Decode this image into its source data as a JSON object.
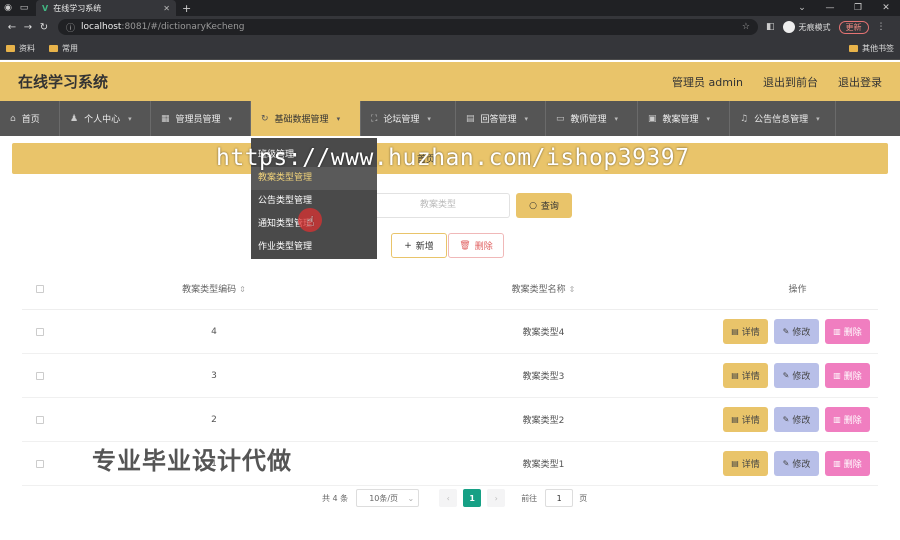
{
  "browser": {
    "tab_title": "在线学习系统",
    "url_host": "localhost",
    "url_path": ":8081/#/dictionaryKecheng",
    "profile_label": "无痕模式",
    "update_label": "更新",
    "bookmarks": [
      "资料",
      "常用"
    ],
    "other_bookmarks": "其他书签"
  },
  "header": {
    "title": "在线学习系统",
    "user": "管理员 admin",
    "back_front": "退出到前台",
    "logout": "退出登录"
  },
  "nav": [
    {
      "label": "首页",
      "icon": "home-icon"
    },
    {
      "label": "个人中心",
      "icon": "user-icon"
    },
    {
      "label": "管理员管理",
      "icon": "grid-icon"
    },
    {
      "label": "基础数据管理",
      "icon": "refresh-icon",
      "active": true
    },
    {
      "label": "论坛管理",
      "icon": "expand-icon"
    },
    {
      "label": "回答管理",
      "icon": "doc-icon"
    },
    {
      "label": "教师管理",
      "icon": "monitor-icon"
    },
    {
      "label": "教案管理",
      "icon": "box-icon"
    },
    {
      "label": "公告信息管理",
      "icon": "bell-icon"
    }
  ],
  "breadcrumb": "首页",
  "dropdown": [
    "班级管理",
    "教案类型管理",
    "公告类型管理",
    "通知类型管理",
    "作业类型管理"
  ],
  "search": {
    "placeholder": "教案类型",
    "query_label": "查询"
  },
  "actions": {
    "add_label": "新增",
    "delete_label": "删除"
  },
  "table": {
    "headers": {
      "code": "教案类型编码",
      "name": "教案类型名称",
      "ops": "操作"
    },
    "rows": [
      {
        "code": "4",
        "name": "教案类型4"
      },
      {
        "code": "3",
        "name": "教案类型3"
      },
      {
        "code": "2",
        "name": "教案类型2"
      },
      {
        "code": "1",
        "name": "教案类型1"
      }
    ],
    "op_labels": {
      "detail": "详情",
      "edit": "修改",
      "delete": "删除"
    }
  },
  "pagination": {
    "total": "共 4 条",
    "page_size": "10条/页",
    "current": "1",
    "goto": "前往",
    "goto_value": "1",
    "page_unit": "页"
  },
  "overlay": {
    "watermark": "https://www.huzhan.com/ishop39397",
    "promo": "专业毕业设计代做"
  },
  "colors": {
    "accent": "#e9c46a",
    "nav_bg": "#555555",
    "edit": "#b8bfe8",
    "delete": "#f07ec0",
    "page_active": "#16a085"
  }
}
